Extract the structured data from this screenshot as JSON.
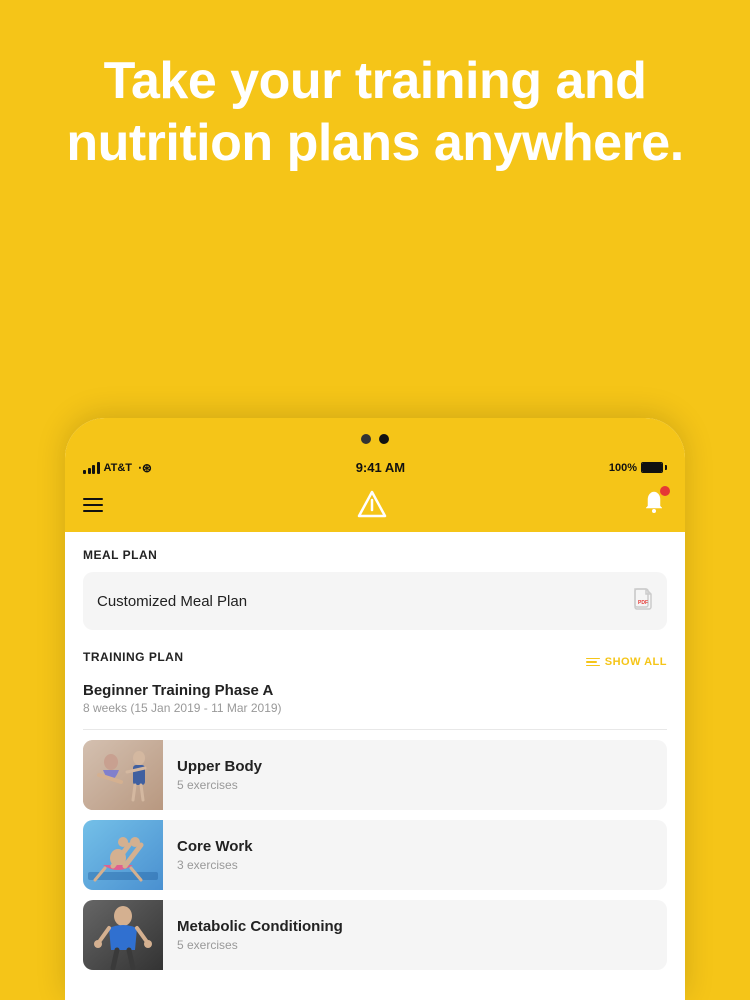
{
  "hero": {
    "headline": "Take your training and nutrition plans anywhere."
  },
  "pagination": {
    "dots": [
      {
        "active": false
      },
      {
        "active": true
      }
    ]
  },
  "statusBar": {
    "carrier": "AT&T",
    "time": "9:41 AM",
    "battery": "100%"
  },
  "header": {
    "logo_alt": "App Logo"
  },
  "mealPlan": {
    "section_label": "MEAL PLAN",
    "item_label": "Customized Meal Plan"
  },
  "trainingPlan": {
    "section_label": "TRAINING PLAN",
    "show_all_label": "SHOW ALL",
    "plan_name": "Beginner Training Phase A",
    "plan_dates": "8 weeks (15 Jan 2019 - 11 Mar 2019)",
    "workouts": [
      {
        "name": "Upper Body",
        "exercises": "5 exercises",
        "thumb_type": "upper"
      },
      {
        "name": "Core Work",
        "exercises": "3 exercises",
        "thumb_type": "core"
      },
      {
        "name": "Metabolic Conditioning",
        "exercises": "5 exercises",
        "thumb_type": "metcon"
      }
    ]
  }
}
